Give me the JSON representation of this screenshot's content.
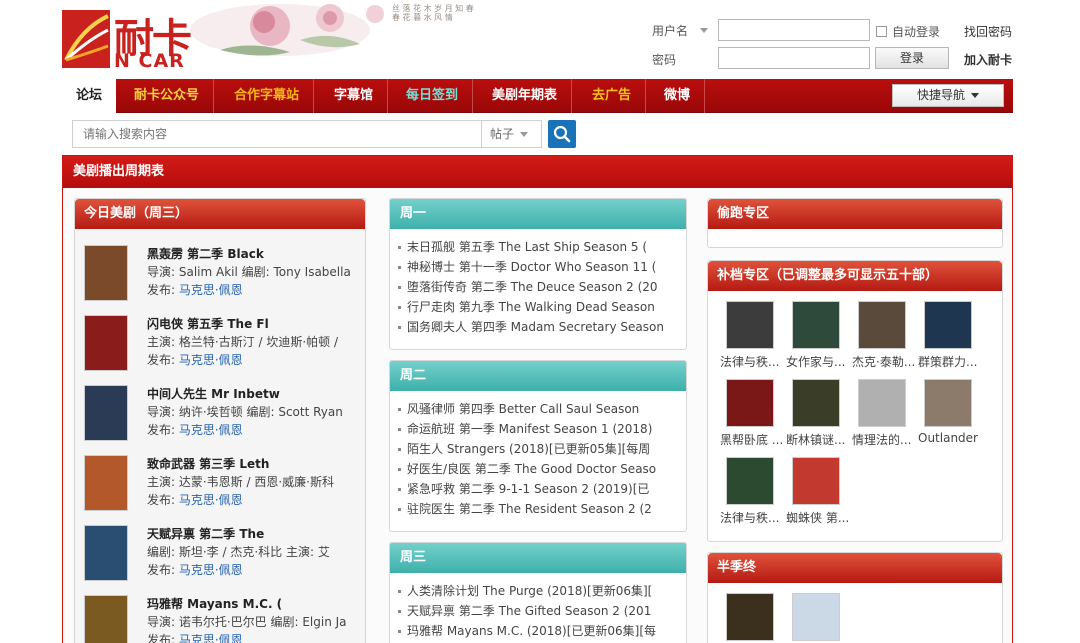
{
  "header": {
    "logo_cn": "耐卡",
    "logo_en": "N CAR",
    "poem": "丝 落 花 木 岁 月 知 春 春 花 暮 水 风 情",
    "login": {
      "username_label": "用户名",
      "password_label": "密码",
      "auto_login": "自动登录",
      "forgot": "找回密码",
      "login_btn": "登录",
      "join": "加入耐卡"
    }
  },
  "nav": {
    "items": [
      "论坛",
      "耐卡公众号",
      "合作字幕站",
      "字幕馆",
      "每日签到",
      "美剧年期表",
      "去广告",
      "微博"
    ],
    "colors": [
      "#222222",
      "#f6d23b",
      "#f7b51c",
      "#ffffff",
      "#75e2da",
      "#ffffff",
      "#f7c21b",
      "#ffffff"
    ],
    "quick": "快捷导航"
  },
  "search": {
    "placeholder": "请输入搜索内容",
    "type": "帖子"
  },
  "panel": {
    "title": "美剧播出周期表",
    "today": {
      "title": "今日美剧（周三）",
      "shows": [
        {
          "t": "黑轰雳 第二季 Black",
          "l2": "导演: Salim Akil 编剧: Tony Isabella",
          "l3p": "发布: ",
          "l3b": "马克思·佩恩",
          "poster": "#7a4a2a"
        },
        {
          "t": "闪电侠 第五季 The Fl",
          "l2": "主演: 格兰特·古斯汀 / 坎迪斯·帕顿 /",
          "l3p": "发布: ",
          "l3b": "马克思·佩恩",
          "poster": "#8b1c1c"
        },
        {
          "t": "中间人先生 Mr Inbetw",
          "l2": "导演: 纳许·埃哲顿 编剧: Scott Ryan",
          "l3p": "发布: ",
          "l3b": "马克思·佩恩",
          "poster": "#2b3b55"
        },
        {
          "t": "致命武器 第三季 Leth",
          "l2": "主演: 达蒙·韦恩斯 / 西恩·威廉·斯科",
          "l3p": "发布: ",
          "l3b": "马克思·佩恩",
          "poster": "#b3582a"
        },
        {
          "t": "天赋异禀 第二季 The",
          "l2": "编剧: 斯坦·李 / 杰克·科比 主演: 艾",
          "l3p": "发布: ",
          "l3b": "马克思·佩恩",
          "poster": "#2a4d72"
        },
        {
          "t": "玛雅帮 Mayans M.C. (",
          "l2": "导演: 诺韦尔托·巴尔巴 编剧: Elgin Ja",
          "l3p": "发布: ",
          "l3b": "马克思·佩恩",
          "poster": "#7a5a20"
        }
      ]
    },
    "days": [
      {
        "title": "周一",
        "items": [
          "末日孤舰 第五季 The Last Ship Season 5 (",
          "神秘博士 第十一季 Doctor Who Season 11 (",
          "堕落街传奇 第二季 The Deuce Season 2 (20",
          "行尸走肉 第九季 The Walking Dead Season",
          "国务卿夫人 第四季 Madam Secretary Season"
        ]
      },
      {
        "title": "周二",
        "items": [
          "风骚律师 第四季 Better Call Saul Season",
          "命运航班 第一季 Manifest Season 1 (2018)",
          "陌生人 Strangers (2018)[已更新05集][每周",
          "好医生/良医 第二季 The Good Doctor Seaso",
          "紧急呼救 第二季 9-1-1 Season 2 (2019)[已",
          "驻院医生 第二季 The Resident Season 2 (2"
        ]
      },
      {
        "title": "周三",
        "items": [
          "人类清除计划 The Purge (2018)[更新06集][",
          "天赋异禀 第二季 The Gifted Season 2 (201",
          "玛雅帮 Mayans M.C. (2018)[已更新06集][每"
        ]
      }
    ],
    "right": {
      "run_title": "偷跑专区",
      "bu_title": "补档专区（已调整最多可显示五十部）",
      "thumbs": [
        {
          "cap": "法律与秩...",
          "color": "#3c3c3c"
        },
        {
          "cap": "女作家与...",
          "color": "#2d4a3a"
        },
        {
          "cap": "杰克·泰勒...",
          "color": "#5a4a3c"
        },
        {
          "cap": "群策群力...",
          "color": "#1e3650"
        },
        {
          "cap": "黑帮卧底 ...",
          "color": "#7a1717"
        },
        {
          "cap": "断林镇谜...",
          "color": "#3a3d28"
        },
        {
          "cap": "情理法的...",
          "color": "#b0b0b0"
        },
        {
          "cap": "Outlander ...",
          "color": "#8c7a6a"
        },
        {
          "cap": "法律与秩...",
          "color": "#2c4a30"
        },
        {
          "cap": "蜘蛛侠 第...",
          "color": "#c23a2f"
        }
      ],
      "half_title": "半季终",
      "half_thumbs": [
        {
          "color": "#3b2f1e"
        },
        {
          "color": "#cbd9e6"
        }
      ]
    }
  }
}
